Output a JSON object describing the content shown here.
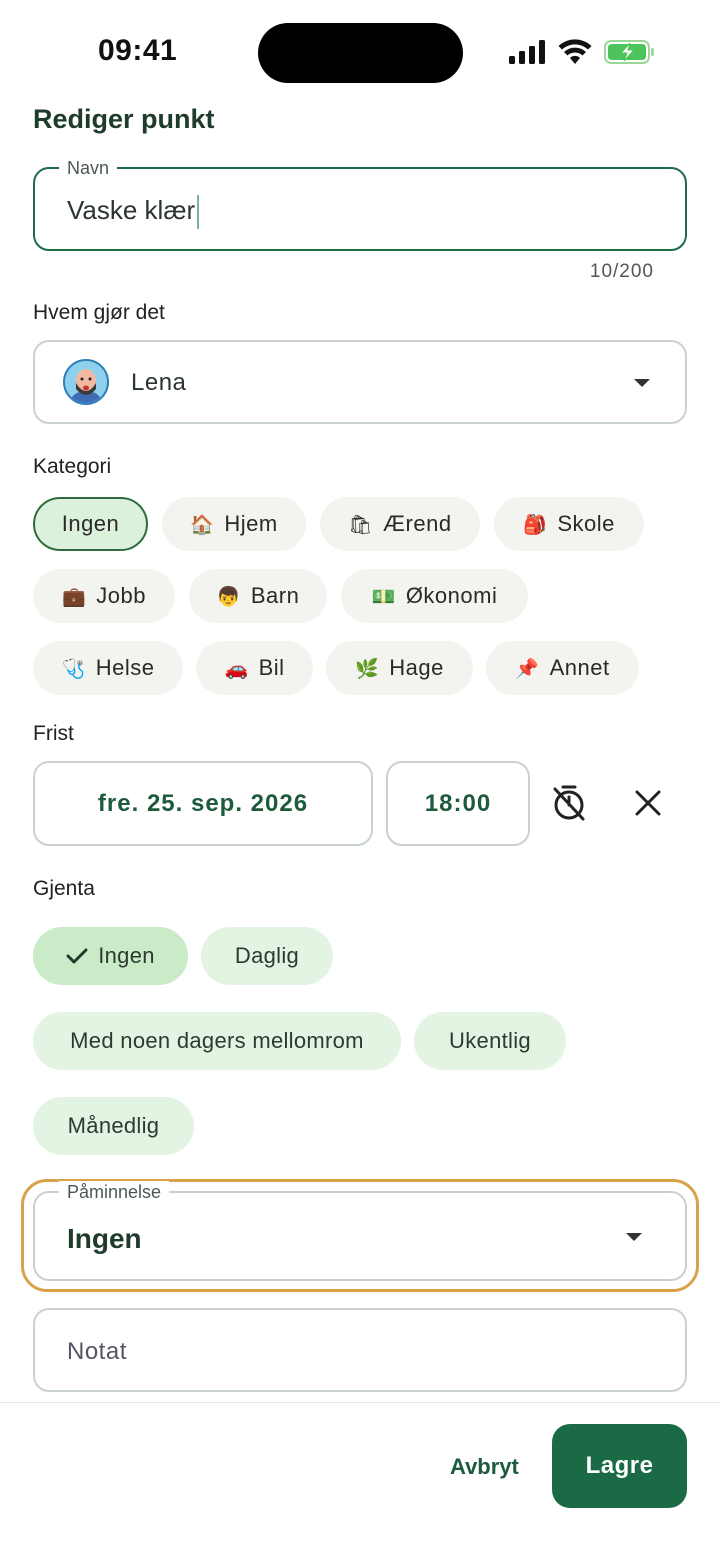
{
  "status_bar": {
    "time": "09:41"
  },
  "title": "Rediger punkt",
  "name_field": {
    "label": "Navn",
    "value": "Vaske klær",
    "counter": "10/200"
  },
  "assignee": {
    "label": "Hvem gjør det",
    "value": "Lena"
  },
  "category": {
    "label": "Kategori",
    "chips": [
      {
        "label": "Ingen",
        "emoji": "",
        "selected": true
      },
      {
        "label": "Hjem",
        "emoji": "🏠"
      },
      {
        "label": "Ærend",
        "emoji": "🛍"
      },
      {
        "label": "Skole",
        "emoji": "🎒"
      },
      {
        "label": "Jobb",
        "emoji": "💼"
      },
      {
        "label": "Barn",
        "emoji": "👦"
      },
      {
        "label": "Økonomi",
        "emoji": "💵"
      },
      {
        "label": "Helse",
        "emoji": "🩺"
      },
      {
        "label": "Bil",
        "emoji": "🚗"
      },
      {
        "label": "Hage",
        "emoji": "🌿"
      },
      {
        "label": "Annet",
        "emoji": "📌"
      }
    ]
  },
  "deadline": {
    "label": "Frist",
    "date": "fre. 25. sep. 2026",
    "time": "18:00"
  },
  "repeat": {
    "label": "Gjenta",
    "options": [
      {
        "label": "Ingen",
        "selected": true
      },
      {
        "label": "Daglig"
      },
      {
        "label": "Med noen dagers mellomrom"
      },
      {
        "label": "Ukentlig"
      },
      {
        "label": "Månedlig"
      }
    ]
  },
  "reminder": {
    "label": "Påminnelse",
    "value": "Ingen"
  },
  "note": {
    "placeholder": "Notat"
  },
  "footer": {
    "cancel_label": "Avbryt",
    "save_label": "Lagre"
  },
  "colors": {
    "accent": "#1a6a46",
    "selected_chip": "#dcf1dc",
    "focus_glow": "#d9a24a"
  }
}
